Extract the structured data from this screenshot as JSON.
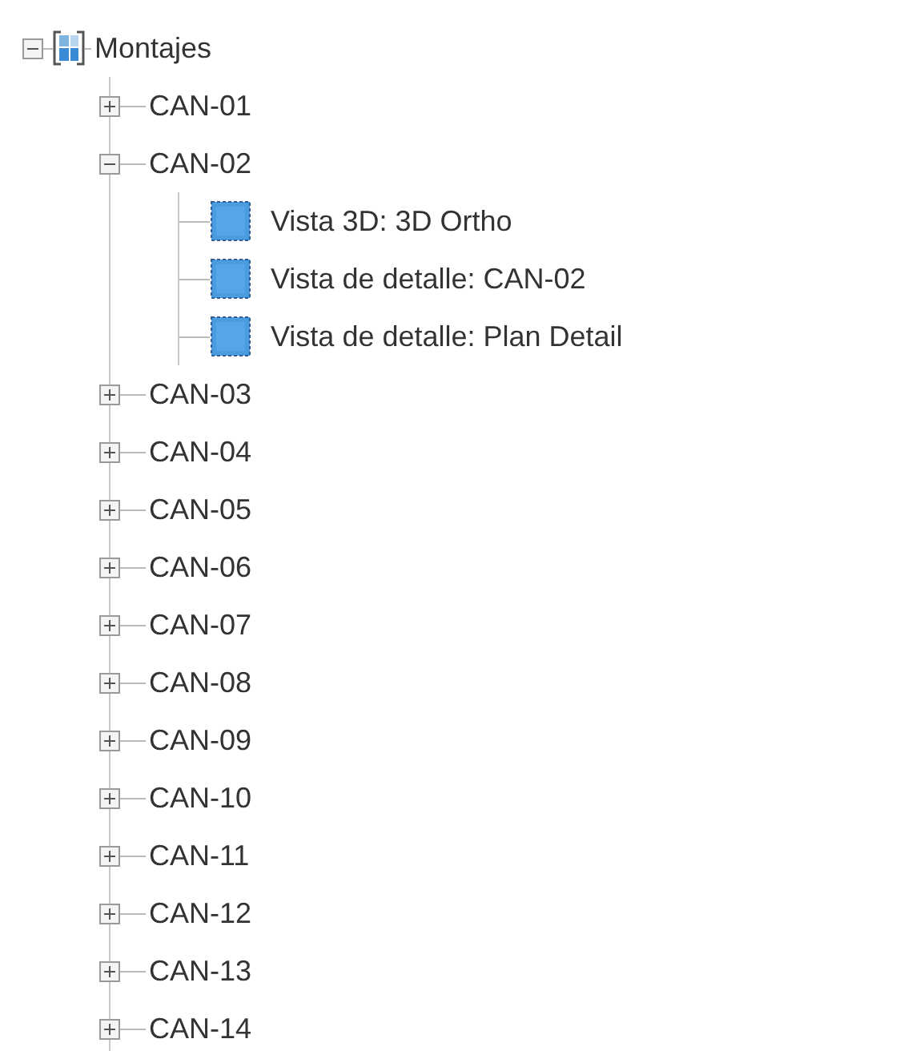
{
  "tree": {
    "label": "Montajes",
    "expanded": true,
    "children": [
      {
        "label": "CAN-01",
        "expanded": false
      },
      {
        "label": "CAN-02",
        "expanded": true,
        "children": [
          {
            "label": "Vista 3D: 3D Ortho"
          },
          {
            "label": "Vista de detalle: CAN-02"
          },
          {
            "label": "Vista de detalle: Plan Detail"
          }
        ]
      },
      {
        "label": "CAN-03",
        "expanded": false
      },
      {
        "label": "CAN-04",
        "expanded": false
      },
      {
        "label": "CAN-05",
        "expanded": false
      },
      {
        "label": "CAN-06",
        "expanded": false
      },
      {
        "label": "CAN-07",
        "expanded": false
      },
      {
        "label": "CAN-08",
        "expanded": false
      },
      {
        "label": "CAN-09",
        "expanded": false
      },
      {
        "label": "CAN-10",
        "expanded": false
      },
      {
        "label": "CAN-11",
        "expanded": false
      },
      {
        "label": "CAN-12",
        "expanded": false
      },
      {
        "label": "CAN-13",
        "expanded": false
      },
      {
        "label": "CAN-14",
        "expanded": false
      }
    ]
  }
}
